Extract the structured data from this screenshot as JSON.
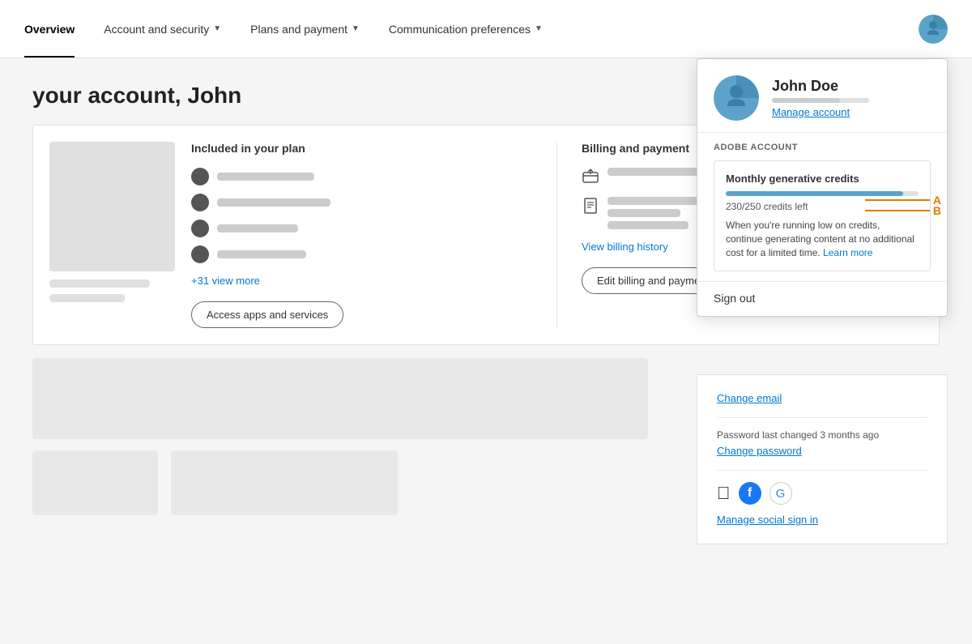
{
  "nav": {
    "items": [
      {
        "id": "overview",
        "label": "Overview",
        "active": true,
        "hasDropdown": false
      },
      {
        "id": "account-security",
        "label": "Account and security",
        "active": false,
        "hasDropdown": true
      },
      {
        "id": "plans-payment",
        "label": "Plans and payment",
        "active": false,
        "hasDropdown": true
      },
      {
        "id": "communication",
        "label": "Communication preferences",
        "active": false,
        "hasDropdown": true
      }
    ]
  },
  "page": {
    "title": "your account, John"
  },
  "plan_section": {
    "title": "Included in your plan",
    "view_more": "+31 view more",
    "access_button": "Access apps and services"
  },
  "billing_section": {
    "title": "Billing and payment",
    "view_history": "View billing history",
    "edit_button": "Edit billing and payment"
  },
  "dropdown": {
    "user_name": "John Doe",
    "manage_account": "Manage account",
    "adobe_account_label": "ADOBE ACCOUNT",
    "credits": {
      "title": "Monthly generative credits",
      "count_label": "230/250 credits left",
      "fill_percent": 92,
      "description": "When you're running low on credits, continue generating content at no additional cost for a limited time.",
      "learn_more": "Learn more"
    },
    "sign_out": "Sign out"
  },
  "right_panel": {
    "change_email": "Change email",
    "password_text": "Password last changed 3 months ago",
    "change_password": "Change password",
    "manage_social": "Manage social sign in"
  },
  "annotations": {
    "a": "A",
    "b": "B"
  }
}
